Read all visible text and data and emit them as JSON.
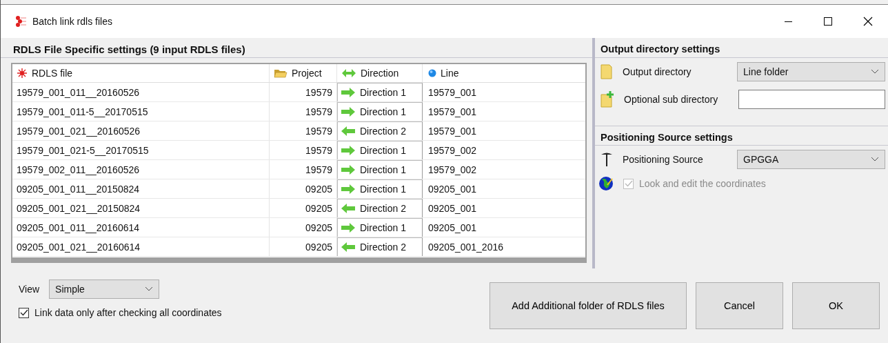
{
  "window": {
    "title": "Batch link rdls files"
  },
  "files_panel": {
    "title": "RDLS File Specific settings (9 input RDLS files)",
    "table": {
      "columns": [
        "RDLS file",
        "Project",
        "Direction",
        "Line"
      ],
      "rows": [
        {
          "file": "19579_001_011__20160526",
          "project": "19579",
          "kind": "forward",
          "direction": "Direction 1",
          "line": "19579_001"
        },
        {
          "file": "19579_001_011-5__20170515",
          "project": "19579",
          "kind": "forward",
          "direction": "Direction 1",
          "line": "19579_001"
        },
        {
          "file": "19579_001_021__20160526",
          "project": "19579",
          "kind": "backward",
          "direction": "Direction 2",
          "line": "19579_001"
        },
        {
          "file": "19579_001_021-5__20170515",
          "project": "19579",
          "kind": "forward",
          "direction": "Direction 1",
          "line": "19579_002"
        },
        {
          "file": "19579_002_011__20160526",
          "project": "19579",
          "kind": "forward",
          "direction": "Direction 1",
          "line": "19579_002"
        },
        {
          "file": "09205_001_011__20150824",
          "project": "09205",
          "kind": "forward",
          "direction": "Direction 1",
          "line": "09205_001"
        },
        {
          "file": "09205_001_021__20150824",
          "project": "09205",
          "kind": "backward",
          "direction": "Direction 2",
          "line": "09205_001"
        },
        {
          "file": "09205_001_011__20160614",
          "project": "09205",
          "kind": "forward",
          "direction": "Direction 1",
          "line": "09205_001"
        },
        {
          "file": "09205_001_021__20160614",
          "project": "09205",
          "kind": "backward",
          "direction": "Direction 2",
          "line": "09205_001_2016"
        }
      ]
    }
  },
  "output_settings": {
    "title": "Output directory settings",
    "output_directory_label": "Output directory",
    "output_directory_value": "Line folder",
    "sub_directory_label": "Optional sub directory"
  },
  "positioning_settings": {
    "title": "Positioning Source settings",
    "source_label": "Positioning Source",
    "source_value": "GPGGA",
    "look_edit": {
      "label": "Look and edit the coordinates",
      "checked": true,
      "disabled": true
    }
  },
  "view": {
    "label": "View",
    "value": "Simple"
  },
  "link_check": {
    "label": "Link data only after checking all coordinates",
    "checked": true
  },
  "buttons": [
    "Add Additional folder of RDLS files",
    "Cancel",
    "OK"
  ]
}
